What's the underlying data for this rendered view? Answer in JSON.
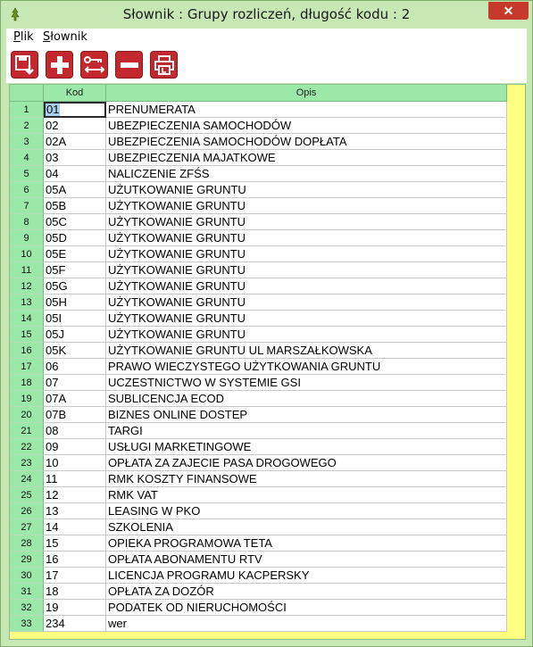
{
  "window": {
    "title": "Słownik : Grupy rozliczeń,  długość kodu : 2",
    "close_label": "✕"
  },
  "menu": {
    "items": [
      {
        "label": "Plik",
        "accel": "P",
        "rest": "lik"
      },
      {
        "label": "Słownik",
        "accel": "S",
        "rest": "łownik"
      }
    ]
  },
  "toolbar": {
    "buttons": [
      {
        "name": "save-button",
        "icon": "save-export-icon"
      },
      {
        "name": "add-button",
        "icon": "plus-icon"
      },
      {
        "name": "key-swap-button",
        "icon": "key-arrows-icon"
      },
      {
        "name": "delete-button",
        "icon": "minus-icon"
      },
      {
        "name": "print-button",
        "icon": "printer-icon"
      }
    ]
  },
  "grid": {
    "columns": {
      "rownum": "",
      "kod": "Kod",
      "opis": "Opis"
    },
    "rows": [
      {
        "n": "1",
        "kod": "01",
        "opis": "PRENUMERATA"
      },
      {
        "n": "2",
        "kod": "02",
        "opis": "UBEZPIECZENIA SAMOCHODÓW"
      },
      {
        "n": "3",
        "kod": "02A",
        "opis": "UBEZPIECZENIA SAMOCHODÓW DOPŁATA"
      },
      {
        "n": "4",
        "kod": "03",
        "opis": "UBEZPIECZENIA MAJATKOWE"
      },
      {
        "n": "5",
        "kod": "04",
        "opis": "NALICZENIE ZFŚS"
      },
      {
        "n": "6",
        "kod": "05A",
        "opis": "UŻUTKOWANIE GRUNTU"
      },
      {
        "n": "7",
        "kod": "05B",
        "opis": "UŻYTKOWANIE GRUNTU"
      },
      {
        "n": "8",
        "kod": "05C",
        "opis": "UŻYTKOWANIE GRUNTU"
      },
      {
        "n": "9",
        "kod": "05D",
        "opis": "UŻYTKOWANIE GRUNTU"
      },
      {
        "n": "10",
        "kod": "05E",
        "opis": "UŻYTKOWANIE GRUNTU"
      },
      {
        "n": "11",
        "kod": "05F",
        "opis": "UŻYTKOWANIE GRUNTU"
      },
      {
        "n": "12",
        "kod": "05G",
        "opis": "UŻYTKOWANIE GRUNTU"
      },
      {
        "n": "13",
        "kod": "05H",
        "opis": "UŻYTKOWANIE GRUNTU"
      },
      {
        "n": "14",
        "kod": "05I",
        "opis": "UŻYTKOWANIE GRUNTU"
      },
      {
        "n": "15",
        "kod": "05J",
        "opis": "UŻYTKOWANIE GRUNTU"
      },
      {
        "n": "16",
        "kod": "05K",
        "opis": "UŻYTKOWANIE GRUNTU UL MARSZAŁKOWSKA"
      },
      {
        "n": "17",
        "kod": "06",
        "opis": "PRAWO WIECZYSTEGO UŻYTKOWANIA GRUNTU"
      },
      {
        "n": "18",
        "kod": "07",
        "opis": "UCZESTNICTWO W SYSTEMIE GSI"
      },
      {
        "n": "19",
        "kod": "07A",
        "opis": "SUBLICENCJA ECOD"
      },
      {
        "n": "20",
        "kod": "07B",
        "opis": "BIZNES ONLINE DOSTEP"
      },
      {
        "n": "21",
        "kod": "08",
        "opis": "TARGI"
      },
      {
        "n": "22",
        "kod": "09",
        "opis": "USŁUGI MARKETINGOWE"
      },
      {
        "n": "23",
        "kod": "10",
        "opis": "OPŁATA ZA ZAJECIE PASA DROGOWEGO"
      },
      {
        "n": "24",
        "kod": "11",
        "opis": "RMK KOSZTY FINANSOWE"
      },
      {
        "n": "25",
        "kod": "12",
        "opis": "RMK VAT"
      },
      {
        "n": "26",
        "kod": "13",
        "opis": "LEASING W PKO"
      },
      {
        "n": "27",
        "kod": "14",
        "opis": "SZKOLENIA"
      },
      {
        "n": "28",
        "kod": "15",
        "opis": "OPIEKA PROGRAMOWA TETA"
      },
      {
        "n": "29",
        "kod": "16",
        "opis": "OPŁATA ABONAMENTU RTV"
      },
      {
        "n": "30",
        "kod": "17",
        "opis": "LICENCJA PROGRAMU KACPERSKY"
      },
      {
        "n": "31",
        "kod": "18",
        "opis": "OPŁATA ZA DOZÓR"
      },
      {
        "n": "32",
        "kod": "19",
        "opis": "PODATEK OD NIERUCHOMOŚCI"
      },
      {
        "n": "33",
        "kod": "234",
        "opis": "wer"
      }
    ]
  },
  "colors": {
    "window_frame": "#c7e7b5",
    "header_green": "#9be8a8",
    "toolbar_button_red": "#c4282f",
    "empty_area_yellow": "#ffff80",
    "selection_blue": "#a9cff0"
  }
}
